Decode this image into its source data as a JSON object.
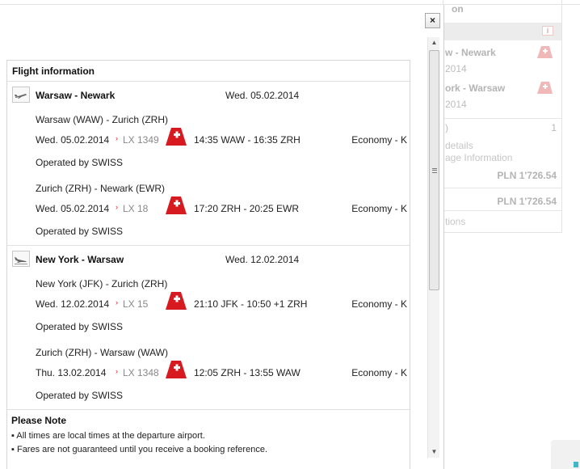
{
  "background": {
    "panel_header": "on",
    "info_badge": "i",
    "routes": [
      {
        "name": "w - Newark",
        "date": "2014"
      },
      {
        "name": "ork - Warsaw",
        "date": "2014"
      }
    ],
    "count_label": ")",
    "count_value": "1",
    "link1": "details",
    "link2": "age Information",
    "price1": "PLN 1'726.54",
    "price2": "PLN 1'726.54",
    "footer_text": "tions"
  },
  "modal": {
    "close_label": "×",
    "title": "Flight information",
    "routes": [
      {
        "name": "Warsaw - Newark",
        "date": "Wed. 05.02.2014",
        "icon": "plane-takeoff-icon",
        "segments": [
          {
            "leg": "Warsaw (WAW) - Zurich (ZRH)",
            "date": "Wed. 05.02.2014",
            "flight": "LX 1349",
            "times": "14:35 WAW - 16:35 ZRH",
            "cabin": "Economy - K",
            "operated": "Operated by SWISS"
          },
          {
            "leg": "Zurich (ZRH) - Newark (EWR)",
            "date": "Wed. 05.02.2014",
            "flight": "LX 18",
            "times": "17:20 ZRH - 20:25 EWR",
            "cabin": "Economy - K",
            "operated": "Operated by SWISS"
          }
        ]
      },
      {
        "name": "New York - Warsaw",
        "date": "Wed. 12.02.2014",
        "icon": "plane-landing-icon",
        "segments": [
          {
            "leg": "New York (JFK) - Zurich (ZRH)",
            "date": "Wed. 12.02.2014",
            "flight": "LX 15",
            "times": "21:10 JFK - 10:50 +1 ZRH",
            "cabin": "Economy - K",
            "operated": "Operated by SWISS"
          },
          {
            "leg": "Zurich (ZRH) - Warsaw (WAW)",
            "date": "Thu. 13.02.2014",
            "flight": "LX 1348",
            "times": "12:05 ZRH - 13:55 WAW",
            "cabin": "Economy - K",
            "operated": "Operated by SWISS"
          }
        ]
      }
    ],
    "note_title": "Please Note",
    "notes": [
      "All times are local times at the departure airport.",
      "Fares are not guaranteed until you receive a booking reference."
    ],
    "flight_arrow": "›"
  },
  "colors": {
    "swiss_red": "#d71920",
    "accent_teal": "#41b6c7"
  }
}
